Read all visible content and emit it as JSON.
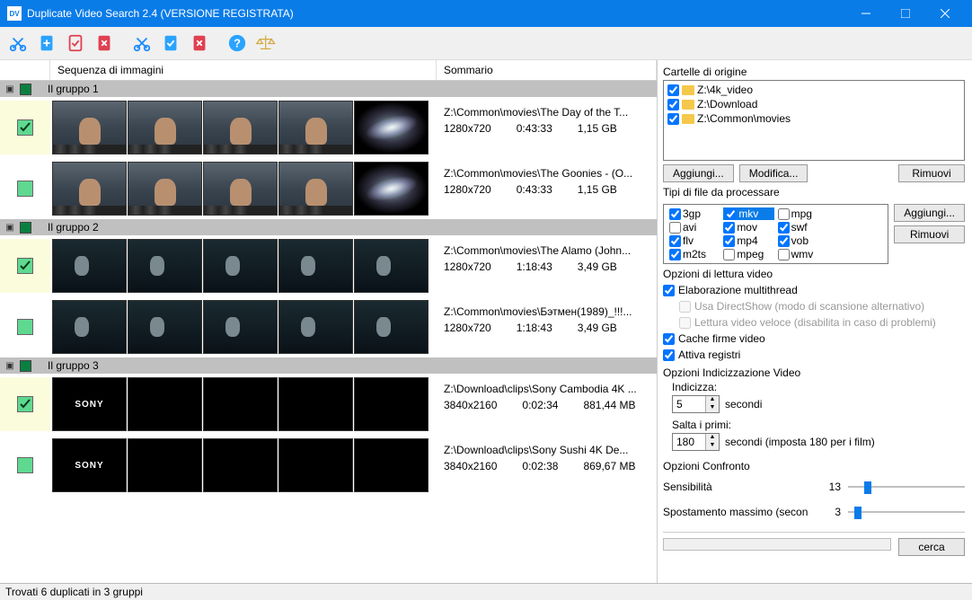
{
  "window": {
    "title": "Duplicate Video Search 2.4 (VERSIONE REGISTRATA)"
  },
  "toolbar_icons": [
    "cut",
    "file-new",
    "file-check",
    "file-delete",
    "cut-2",
    "file-new-2",
    "file-delete-2",
    "help",
    "balance-scale"
  ],
  "headers": {
    "seq": "Sequenza di immagini",
    "sum": "Sommario"
  },
  "groups": [
    {
      "title": "Il gruppo 1",
      "items": [
        {
          "checked": true,
          "thumb_type": "man",
          "thumb_last": "galaxy",
          "path": "Z:\\Common\\movies\\The Day of the T...",
          "res": "1280x720",
          "dur": "0:43:33",
          "size": "1,15 GB"
        },
        {
          "checked": false,
          "thumb_type": "man",
          "thumb_last": "galaxy",
          "path": "Z:\\Common\\movies\\The Goonies - (O...",
          "res": "1280x720",
          "dur": "0:43:33",
          "size": "1,15 GB"
        }
      ]
    },
    {
      "title": "Il gruppo 2",
      "items": [
        {
          "checked": true,
          "thumb_type": "forest",
          "thumb_last": "forest",
          "path": "Z:\\Common\\movies\\The Alamo (John...",
          "res": "1280x720",
          "dur": "1:18:43",
          "size": "3,49 GB"
        },
        {
          "checked": false,
          "thumb_type": "forest",
          "thumb_last": "forest",
          "path": "Z:\\Common\\movies\\Бэтмен(1989)_!!!...",
          "res": "1280x720",
          "dur": "1:18:43",
          "size": "3,49 GB"
        }
      ]
    },
    {
      "title": "Il gruppo 3",
      "items": [
        {
          "checked": true,
          "thumb_type": "sony",
          "thumb_last": "black",
          "path": "Z:\\Download\\clips\\Sony Cambodia 4K ...",
          "res": "3840x2160",
          "dur": "0:02:34",
          "size": "881,44 MB"
        },
        {
          "checked": false,
          "thumb_type": "sony",
          "thumb_last": "black",
          "path": "Z:\\Download\\clips\\Sony Sushi 4K De...",
          "res": "3840x2160",
          "dur": "0:02:38",
          "size": "869,67 MB"
        }
      ]
    }
  ],
  "right": {
    "folders_label": "Cartelle di origine",
    "folders": [
      {
        "checked": true,
        "path": "Z:\\4k_video"
      },
      {
        "checked": true,
        "path": "Z:\\Download"
      },
      {
        "checked": true,
        "path": "Z:\\Common\\movies"
      }
    ],
    "btn_add": "Aggiungi...",
    "btn_edit": "Modifica...",
    "btn_remove": "Rimuovi",
    "types_label": "Tipi di file da processare",
    "types": [
      {
        "ext": "3gp",
        "checked": true,
        "sel": false
      },
      {
        "ext": "mkv",
        "checked": true,
        "sel": true
      },
      {
        "ext": "mpg",
        "checked": false,
        "sel": false
      },
      {
        "ext": "",
        "checked": false,
        "sel": false,
        "blank": true
      },
      {
        "ext": "avi",
        "checked": false,
        "sel": false
      },
      {
        "ext": "mov",
        "checked": true,
        "sel": false
      },
      {
        "ext": "swf",
        "checked": true,
        "sel": false
      },
      {
        "ext": "",
        "checked": false,
        "sel": false,
        "blank": true
      },
      {
        "ext": "flv",
        "checked": true,
        "sel": false
      },
      {
        "ext": "mp4",
        "checked": true,
        "sel": false
      },
      {
        "ext": "vob",
        "checked": true,
        "sel": false
      },
      {
        "ext": "",
        "checked": false,
        "sel": false,
        "blank": true
      },
      {
        "ext": "m2ts",
        "checked": true,
        "sel": false
      },
      {
        "ext": "mpeg",
        "checked": false,
        "sel": false
      },
      {
        "ext": "wmv",
        "checked": false,
        "sel": false
      },
      {
        "ext": "",
        "checked": false,
        "sel": false,
        "blank": true
      }
    ],
    "read_opts_label": "Opzioni di lettura video",
    "opt_multithread": "Elaborazione multithread",
    "opt_directshow": "Usa DirectShow (modo di scansione alternativo)",
    "opt_fastread": "Lettura video veloce (disabilita in caso di problemi)",
    "opt_cache": "Cache firme video",
    "opt_logs": "Attiva registri",
    "idx_label": "Opzioni Indicizzazione Video",
    "idx_index": "Indicizza:",
    "idx_index_val": "5",
    "idx_seconds": "secondi",
    "idx_skip": "Salta i primi:",
    "idx_skip_val": "180",
    "idx_skip_suffix": "secondi (imposta 180 per i film)",
    "cmp_label": "Opzioni Confronto",
    "cmp_sens": "Sensibilità",
    "cmp_sens_val": "13",
    "cmp_shift": "Spostamento massimo (secon",
    "cmp_shift_val": "3",
    "btn_search": "cerca"
  },
  "status": "Trovati 6 duplicati in 3 gruppi"
}
